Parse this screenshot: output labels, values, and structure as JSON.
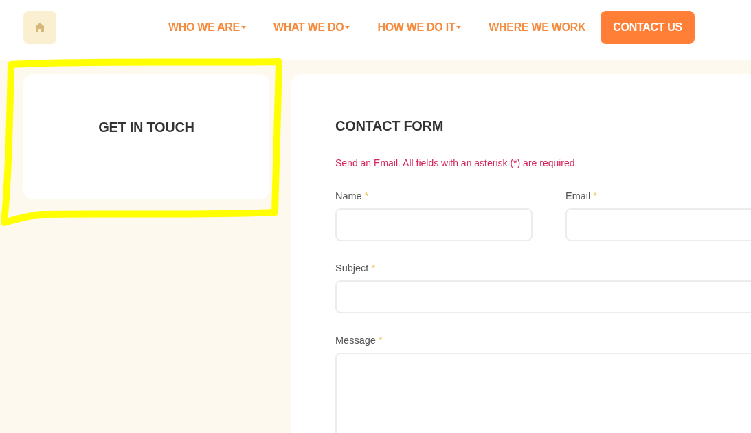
{
  "nav": {
    "items": [
      {
        "label": "WHO WE ARE",
        "has_dropdown": true,
        "selected": false
      },
      {
        "label": "WHAT WE DO",
        "has_dropdown": true,
        "selected": false
      },
      {
        "label": "HOW WE DO IT",
        "has_dropdown": true,
        "selected": false
      },
      {
        "label": "WHERE WE WORK",
        "has_dropdown": false,
        "selected": false
      },
      {
        "label": "CONTACT US",
        "has_dropdown": false,
        "selected": true
      }
    ]
  },
  "sidebar": {
    "title": "GET IN TOUCH"
  },
  "contact_form": {
    "title": "CONTACT FORM",
    "notice": "Send an Email. All fields with an asterisk (*) are required.",
    "rows": [
      [
        {
          "label": "Name",
          "mark": "*",
          "kind": "input"
        },
        {
          "label": "Email",
          "mark": "*",
          "kind": "input"
        }
      ],
      [
        {
          "label": "Subject",
          "mark": "*",
          "kind": "input"
        }
      ],
      [
        {
          "label": "Message",
          "mark": "*",
          "kind": "textarea"
        }
      ]
    ]
  },
  "annotation": {
    "kind": "highlight"
  }
}
